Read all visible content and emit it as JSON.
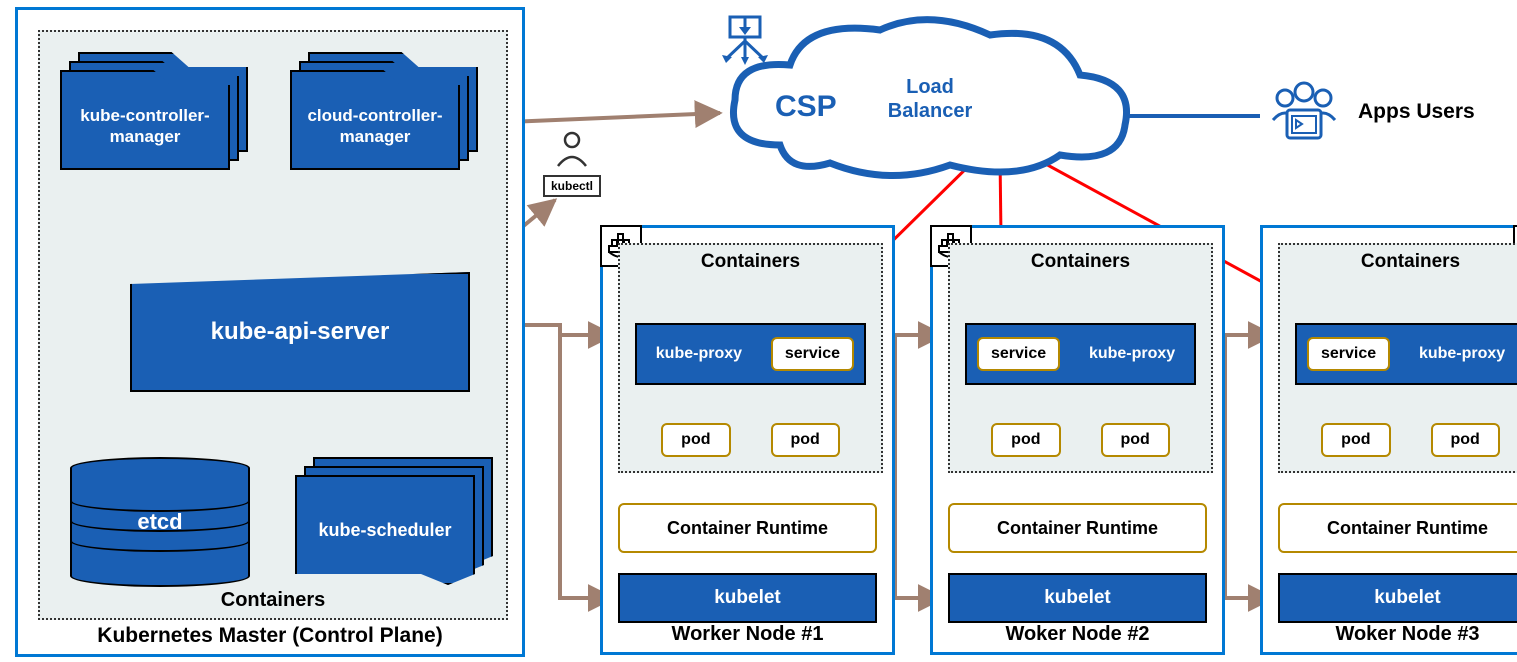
{
  "master": {
    "title": "Kubernetes Master (Control Plane)",
    "containers_label": "Containers",
    "kcm": "kube-controller-manager",
    "ccm": "cloud-controller-manager",
    "api": "kube-api-server",
    "etcd": "etcd",
    "scheduler": "kube-scheduler"
  },
  "kubectl": {
    "label": "kubectl"
  },
  "cloud": {
    "csp": "CSP",
    "lb": "Load Balancer"
  },
  "apps_users": "Apps Users",
  "worker": {
    "containers_label": "Containers",
    "kube_proxy": "kube-proxy",
    "service": "service",
    "pod": "pod",
    "runtime": "Container Runtime",
    "kubelet": "kubelet"
  },
  "workers": [
    {
      "title": "Worker Node #1",
      "service_position": "right",
      "docker_pos": "left"
    },
    {
      "title": "Woker Node #2",
      "service_position": "left",
      "docker_pos": "left"
    },
    {
      "title": "Woker Node #3",
      "service_position": "left",
      "docker_pos": "right"
    }
  ],
  "colors": {
    "blue": "#1a5fb4",
    "accent": "#0078d4",
    "gold": "#b58900",
    "red": "#ff0000",
    "brown": "#a08070"
  }
}
